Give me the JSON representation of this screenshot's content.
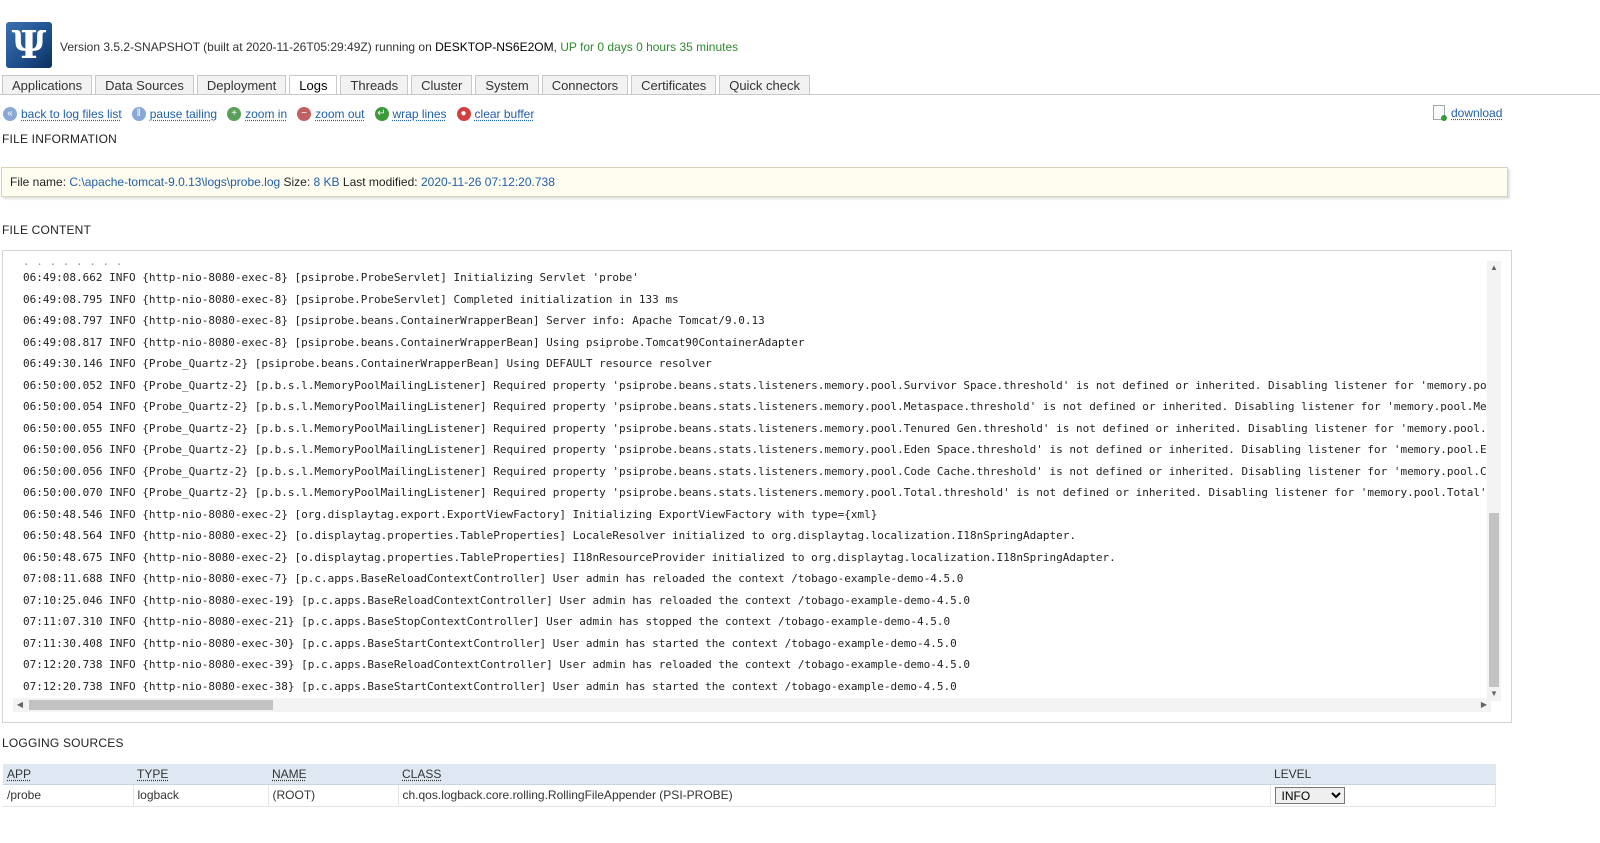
{
  "header": {
    "logo": "Ψ",
    "version_text": "Version 3.5.2-SNAPSHOT (built at 2020-11-26T05:29:49Z) running on ",
    "host": "DESKTOP-NS6E2OM",
    "separator": ", ",
    "uptime": "UP for 0 days 0 hours 35 minutes"
  },
  "tabs": [
    {
      "label": "Applications"
    },
    {
      "label": "Data Sources"
    },
    {
      "label": "Deployment"
    },
    {
      "label": "Logs",
      "active": true
    },
    {
      "label": "Threads"
    },
    {
      "label": "Cluster"
    },
    {
      "label": "System"
    },
    {
      "label": "Connectors"
    },
    {
      "label": "Certificates"
    },
    {
      "label": "Quick check"
    }
  ],
  "toolbar": {
    "back": "back to log files list",
    "pause": "pause tailing",
    "zoom_in": "zoom in",
    "zoom_out": "zoom out",
    "wrap": "wrap lines",
    "clear": "clear buffer",
    "download": "download"
  },
  "file_info": {
    "title": "FILE INFORMATION",
    "name_label": "File name:",
    "name_value": "C:\\apache-tomcat-9.0.13\\logs\\probe.log",
    "size_label": "Size:",
    "size_value": "8 KB",
    "modified_label": "Last modified:",
    "modified_value": "2020-11-26 07:12:20.738"
  },
  "file_content": {
    "title": "FILE CONTENT",
    "lines": [
      "06:49:08.662 INFO {http-nio-8080-exec-8} [psiprobe.ProbeServlet] Initializing Servlet 'probe'",
      "06:49:08.795 INFO {http-nio-8080-exec-8} [psiprobe.ProbeServlet] Completed initialization in 133 ms",
      "06:49:08.797 INFO {http-nio-8080-exec-8} [psiprobe.beans.ContainerWrapperBean] Server info: Apache Tomcat/9.0.13",
      "06:49:08.817 INFO {http-nio-8080-exec-8} [psiprobe.beans.ContainerWrapperBean] Using psiprobe.Tomcat90ContainerAdapter",
      "06:49:30.146 INFO {Probe_Quartz-2} [psiprobe.beans.ContainerWrapperBean] Using DEFAULT resource resolver",
      "06:50:00.052 INFO {Probe_Quartz-2} [p.b.s.l.MemoryPoolMailingListener] Required property 'psiprobe.beans.stats.listeners.memory.pool.Survivor Space.threshold' is not defined or inherited. Disabling listener for 'memory.pool.Sur",
      "06:50:00.054 INFO {Probe_Quartz-2} [p.b.s.l.MemoryPoolMailingListener] Required property 'psiprobe.beans.stats.listeners.memory.pool.Metaspace.threshold' is not defined or inherited. Disabling listener for 'memory.pool.Metaspac",
      "06:50:00.055 INFO {Probe_Quartz-2} [p.b.s.l.MemoryPoolMailingListener] Required property 'psiprobe.beans.stats.listeners.memory.pool.Tenured Gen.threshold' is not defined or inherited. Disabling listener for 'memory.pool.Tenure",
      "06:50:00.056 INFO {Probe_Quartz-2} [p.b.s.l.MemoryPoolMailingListener] Required property 'psiprobe.beans.stats.listeners.memory.pool.Eden Space.threshold' is not defined or inherited. Disabling listener for 'memory.pool.Eden Sp",
      "06:50:00.056 INFO {Probe_Quartz-2} [p.b.s.l.MemoryPoolMailingListener] Required property 'psiprobe.beans.stats.listeners.memory.pool.Code Cache.threshold' is not defined or inherited. Disabling listener for 'memory.pool.Code Ca",
      "06:50:00.070 INFO {Probe_Quartz-2} [p.b.s.l.MemoryPoolMailingListener] Required property 'psiprobe.beans.stats.listeners.memory.pool.Total.threshold' is not defined or inherited. Disabling listener for 'memory.pool.Total' serie",
      "06:50:48.546 INFO {http-nio-8080-exec-2} [org.displaytag.export.ExportViewFactory] Initializing ExportViewFactory with type={xml}",
      "06:50:48.564 INFO {http-nio-8080-exec-2} [o.displaytag.properties.TableProperties] LocaleResolver initialized to org.displaytag.localization.I18nSpringAdapter.",
      "06:50:48.675 INFO {http-nio-8080-exec-2} [o.displaytag.properties.TableProperties] I18nResourceProvider initialized to org.displaytag.localization.I18nSpringAdapter.",
      "07:08:11.688 INFO {http-nio-8080-exec-7} [p.c.apps.BaseReloadContextController] User admin has reloaded the context /tobago-example-demo-4.5.0",
      "07:10:25.046 INFO {http-nio-8080-exec-19} [p.c.apps.BaseReloadContextController] User admin has reloaded the context /tobago-example-demo-4.5.0",
      "07:11:07.310 INFO {http-nio-8080-exec-21} [p.c.apps.BaseStopContextController] User admin has stopped the context /tobago-example-demo-4.5.0",
      "07:11:30.408 INFO {http-nio-8080-exec-30} [p.c.apps.BaseStartContextController] User admin has started the context /tobago-example-demo-4.5.0",
      "07:12:20.738 INFO {http-nio-8080-exec-39} [p.c.apps.BaseReloadContextController] User admin has reloaded the context /tobago-example-demo-4.5.0",
      "07:12:20.738 INFO {http-nio-8080-exec-38} [p.c.apps.BaseStartContextController] User admin has started the context /tobago-example-demo-4.5.0"
    ]
  },
  "logging_sources": {
    "title": "LOGGING SOURCES",
    "columns": [
      "APP",
      "TYPE",
      "NAME",
      "CLASS",
      "LEVEL"
    ],
    "rows": [
      {
        "app": "/probe",
        "type": "logback",
        "name": "(ROOT)",
        "class": "ch.qos.logback.core.rolling.RollingFileAppender (PSI-PROBE)",
        "level": "INFO"
      }
    ]
  },
  "icons": {
    "back": "back-icon",
    "pause": "pause-icon",
    "zoom_in": "zoom-in-icon",
    "zoom_out": "zoom-out-icon",
    "wrap": "wrap-icon",
    "clear": "clear-icon",
    "download": "download-icon"
  },
  "colors": {
    "link": "#2060a8",
    "uptime": "#2e8b2e",
    "info_bg": "#fffcf0",
    "table_header_bg": "#dfe8f2"
  }
}
